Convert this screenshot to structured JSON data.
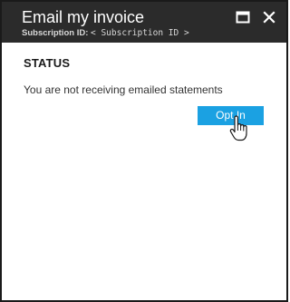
{
  "header": {
    "title": "Email my invoice",
    "subscription_label": "Subscription ID:",
    "subscription_value": "< Subscription ID >",
    "maximize_icon": "maximize-icon",
    "close_icon": "close-icon"
  },
  "status": {
    "heading": "STATUS",
    "message": "You are not receiving emailed statements",
    "button_label": "Opt In"
  },
  "colors": {
    "header_bg": "#2b2b2b",
    "accent": "#1ba1e2"
  },
  "cursor_icon": "hand-pointer-icon"
}
